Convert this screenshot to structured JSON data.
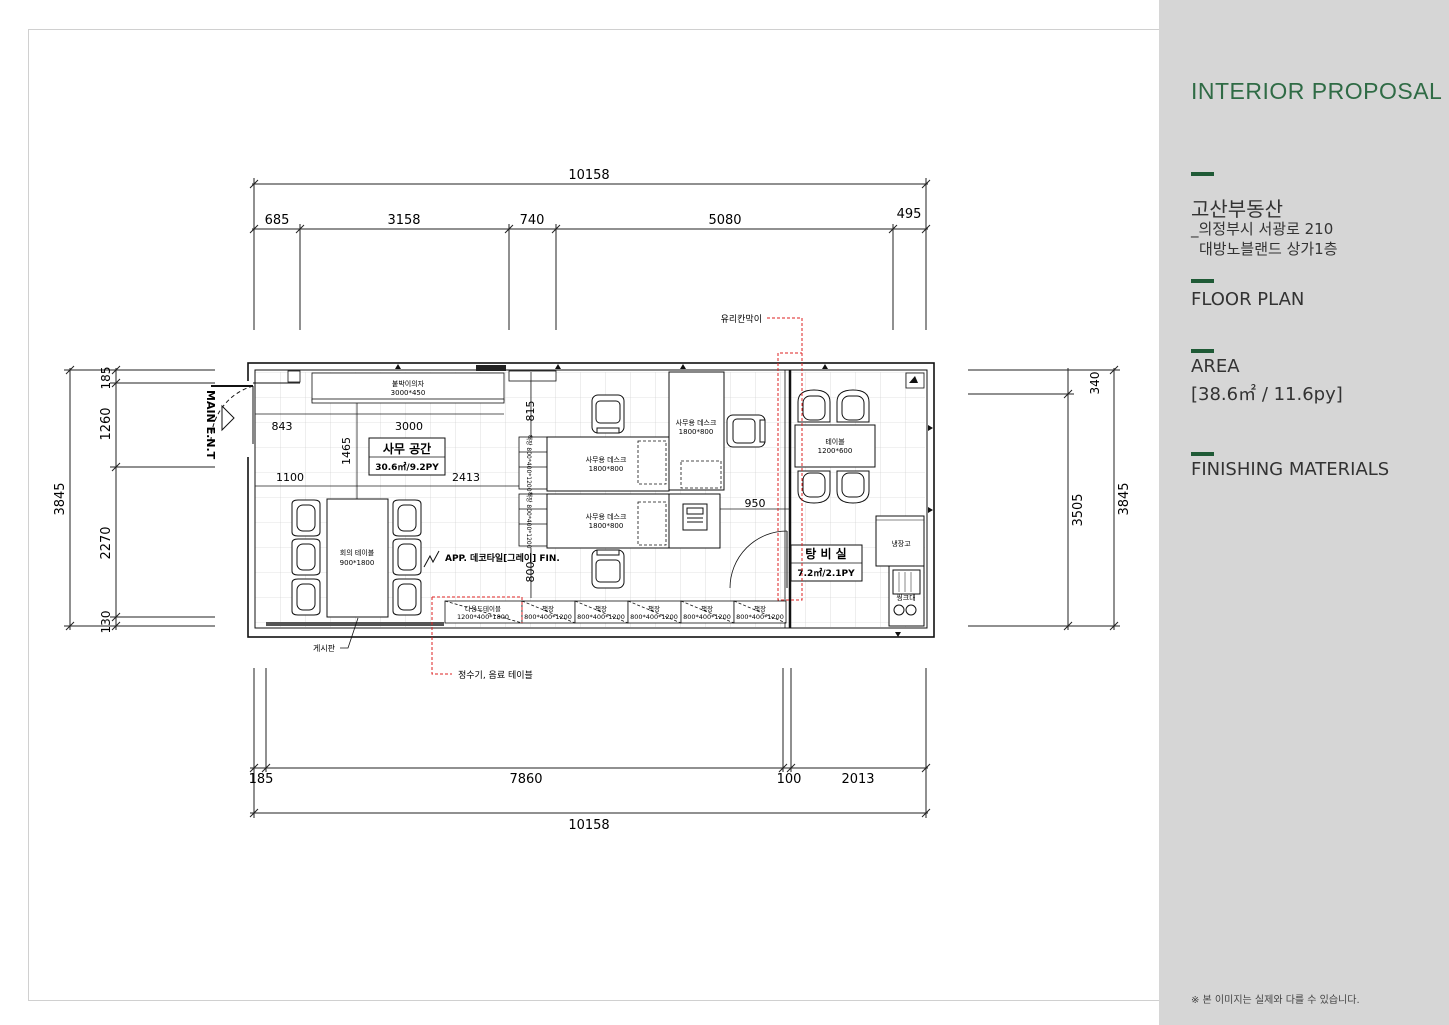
{
  "sidebar": {
    "title": "INTERIOR PROPOSAL",
    "company": "고산부동산",
    "address_line1": "_의정부시 서광로 210",
    "address_line2": "대방노블랜드 상가1층",
    "floor_plan": "FLOOR PLAN",
    "area_label": "AREA",
    "area_value": "[38.6㎡ / 11.6py]",
    "finishing": "FINISHING MATERIALS",
    "note": "※ 본 이미지는 실제와 다를 수 있습니다.",
    "accent_color": "#1f5a36",
    "title_color": "#2f6b45"
  },
  "dimensions": {
    "top_total": "10158",
    "top_1": "685",
    "top_2": "3158",
    "top_3": "740",
    "top_4": "5080",
    "top_5": "495",
    "bottom_total": "10158",
    "bottom_1": "185",
    "bottom_2": "7860",
    "bottom_3": "100",
    "bottom_4": "2013",
    "left_total": "3845",
    "left_1": "185",
    "left_2": "1260",
    "left_3": "2270",
    "left_4": "130",
    "right_total": "3845",
    "right_1": "340",
    "right_2": "3505",
    "inner_843": "843",
    "inner_3000": "3000",
    "inner_1465": "1465",
    "inner_1100": "1100",
    "inner_2413": "2413",
    "inner_815": "815",
    "inner_800": "800",
    "inner_950": "950"
  },
  "labels": {
    "office_space": "사무 공간",
    "office_area": "30.6㎡/9.2PY",
    "pantry": "탕 비 실",
    "pantry_area": "7.2㎡/2.1PY",
    "main_entrance": "MAIN E.N.T",
    "built_in_chair": "붙박이의자",
    "built_in_chair_size": "3000*450",
    "meeting_table": "회의 테이블",
    "meeting_table_size": "900*1800",
    "office_desk": "사무용 데스크",
    "office_desk_size": "1800*800",
    "table": "테이블",
    "table_size": "1200*600",
    "fridge": "냉장고",
    "sink": "씽크대",
    "multi_table": "다용도테이블",
    "multi_table_size": "1200*400*1800",
    "cabinet": "책장",
    "cabinet_size": "800*400*1200",
    "bookshelf_v": "책장 800*400*1200",
    "tile_note": "APP. 데코타일[그레이] FIN.",
    "glass_partition": "유리칸막이",
    "water_dispenser": "정수기, 음료 테이블",
    "bulletin_board": "게시판"
  }
}
